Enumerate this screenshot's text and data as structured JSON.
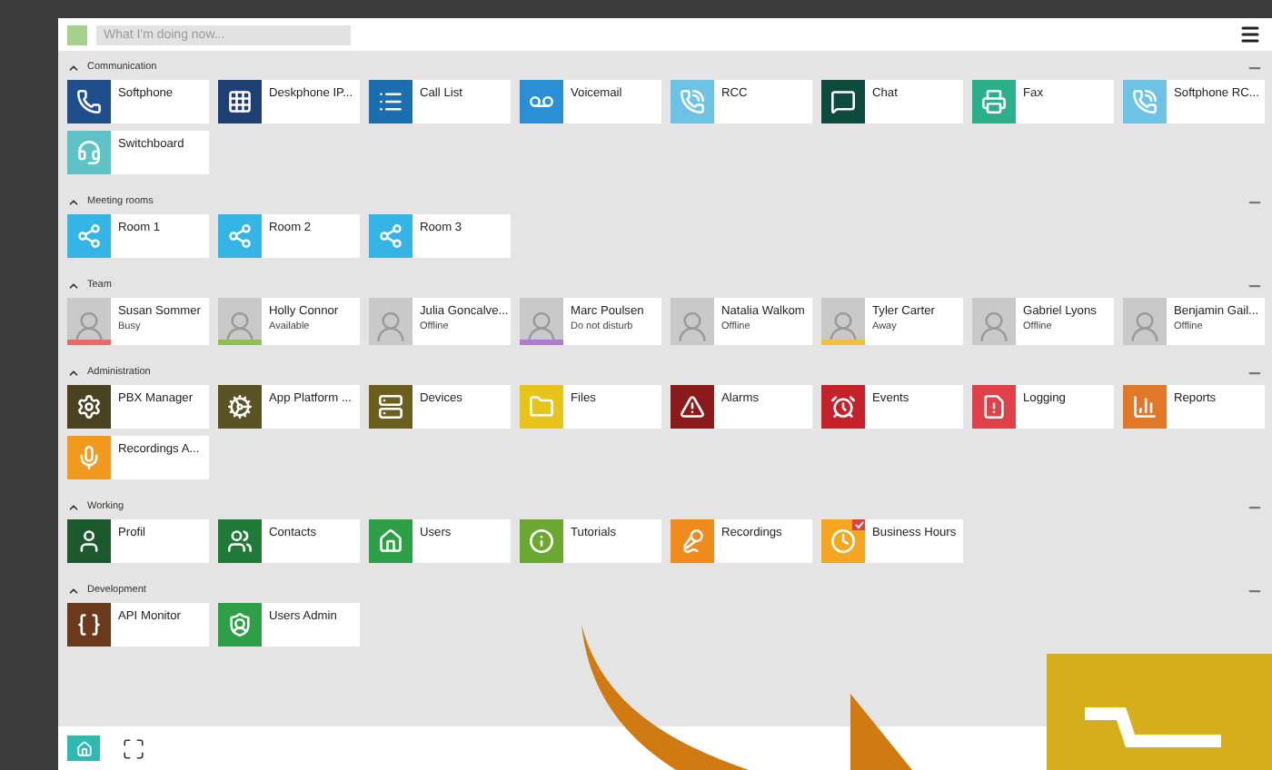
{
  "header": {
    "placeholder": "What I'm doing now..."
  },
  "sections": [
    {
      "title": "Communication",
      "expanded": true,
      "tiles": [
        {
          "kind": "app",
          "label": "Softphone",
          "color": "#1f4e8c"
        },
        {
          "kind": "app",
          "label": "Deskphone IP...",
          "color": "#1d3f73"
        },
        {
          "kind": "app",
          "label": "Call List",
          "color": "#1b6fae"
        },
        {
          "kind": "app",
          "label": "Voicemail",
          "color": "#2b8fd6"
        },
        {
          "kind": "app",
          "label": "RCC",
          "color": "#6cc3e6"
        },
        {
          "kind": "app",
          "label": "Chat",
          "color": "#0e4a3f"
        },
        {
          "kind": "app",
          "label": "Fax",
          "color": "#2bb08a"
        },
        {
          "kind": "app",
          "label": "Softphone RC...",
          "color": "#6cc3e6"
        },
        {
          "kind": "app",
          "label": "Switchboard",
          "color": "#5fc2c6"
        }
      ]
    },
    {
      "title": "Meeting rooms",
      "expanded": true,
      "tiles": [
        {
          "kind": "app",
          "label": "Room 1",
          "color": "#35b5e5"
        },
        {
          "kind": "app",
          "label": "Room 2",
          "color": "#35b5e5"
        },
        {
          "kind": "app",
          "label": "Room 3",
          "color": "#35b5e5"
        }
      ]
    },
    {
      "title": "Team",
      "expanded": true,
      "tiles": [
        {
          "kind": "person",
          "label": "Susan Sommer",
          "status": "Busy",
          "color": "#e86a6a"
        },
        {
          "kind": "person",
          "label": "Holly Connor",
          "status": "Available",
          "color": "#8cc152"
        },
        {
          "kind": "person",
          "label": "Julia Goncalve...",
          "status": "Offline"
        },
        {
          "kind": "person",
          "label": "Marc Poulsen",
          "status": "Do not disturb",
          "color": "#b07ad0"
        },
        {
          "kind": "person",
          "label": "Natalia Walkom",
          "status": "Offline"
        },
        {
          "kind": "person",
          "label": "Tyler Carter",
          "status": "Away",
          "color": "#f0c040"
        },
        {
          "kind": "person",
          "label": "Gabriel Lyons",
          "status": "Offline"
        },
        {
          "kind": "person",
          "label": "Benjamin Gail...",
          "status": "Offline"
        }
      ]
    },
    {
      "title": "Administration",
      "expanded": true,
      "tiles": [
        {
          "kind": "app",
          "label": "PBX Manager",
          "color": "#4a4321"
        },
        {
          "kind": "app",
          "label": "App Platform ...",
          "color": "#5a5425"
        },
        {
          "kind": "app",
          "label": "Devices",
          "color": "#6b5e1e"
        },
        {
          "kind": "app",
          "label": "Files",
          "color": "#e8c31a"
        },
        {
          "kind": "app",
          "label": "Alarms",
          "color": "#8b1a1a"
        },
        {
          "kind": "app",
          "label": "Events",
          "color": "#c4212a"
        },
        {
          "kind": "app",
          "label": "Logging",
          "color": "#e0404a"
        },
        {
          "kind": "app",
          "label": "Reports",
          "color": "#e07828"
        },
        {
          "kind": "app",
          "label": "Recordings A...",
          "color": "#f29a1f"
        }
      ]
    },
    {
      "title": "Working",
      "expanded": true,
      "tiles": [
        {
          "kind": "app",
          "label": "Profil",
          "color": "#1c5a2e"
        },
        {
          "kind": "app",
          "label": "Contacts",
          "color": "#1f7a38"
        },
        {
          "kind": "app",
          "label": "Users",
          "color": "#2e9e47"
        },
        {
          "kind": "app",
          "label": "Tutorials",
          "color": "#6aa832"
        },
        {
          "kind": "app",
          "label": "Recordings",
          "color": "#f08a1d"
        },
        {
          "kind": "app",
          "label": "Business Hours",
          "color": "#f4a622"
        }
      ]
    },
    {
      "title": "Development",
      "expanded": true,
      "tiles": [
        {
          "kind": "app",
          "label": "API Monitor",
          "color": "#6b3a1d"
        },
        {
          "kind": "app",
          "label": "Users Admin",
          "color": "#2e9e47"
        }
      ]
    }
  ]
}
